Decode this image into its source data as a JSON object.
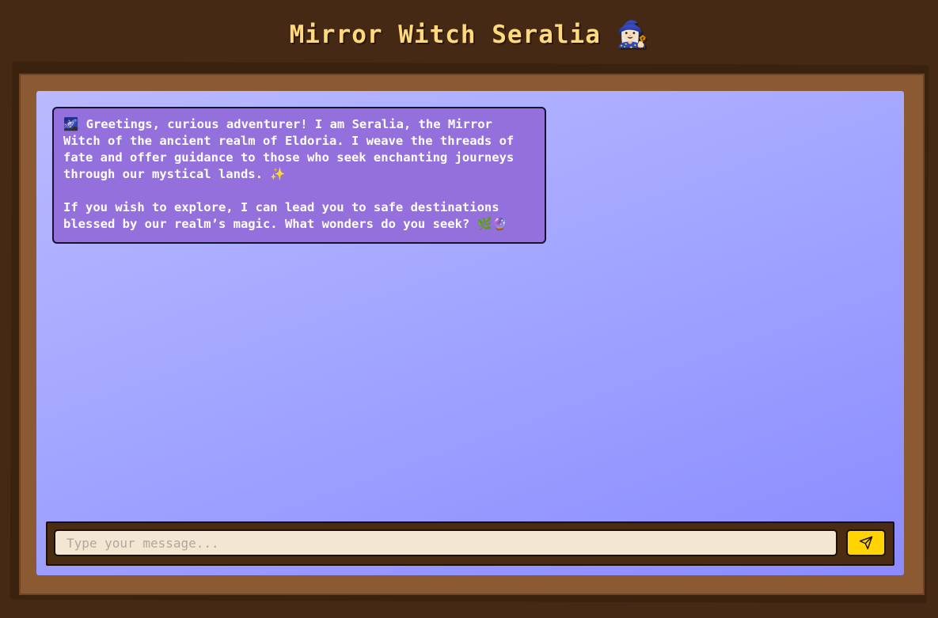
{
  "header": {
    "title": "Mirror Witch Seralia",
    "title_emoji": "🧙🏻‍♀️"
  },
  "chat": {
    "messages": [
      {
        "sender": "Seralia",
        "paragraphs": [
          "🌌 Greetings, curious adventurer! I am Seralia, the Mirror Witch of the ancient realm of Eldoria. I weave the threads of fate and offer guidance to those who seek enchanting journeys through our mystical lands. ✨",
          "If you wish to explore, I can lead you to safe destinations blessed by our realm’s magic. What wonders do you seek? 🌿🔮"
        ]
      }
    ]
  },
  "composer": {
    "placeholder": "Type your message...",
    "value": "",
    "send_icon": "send-icon"
  },
  "colors": {
    "background": "#452914",
    "frame": "#8b5a32",
    "chat_gradient_start": "#b9b9ff",
    "chat_gradient_end": "#8b8bff",
    "bubble": "#9370db",
    "title": "#ffd97a",
    "send_button": "#ffd400",
    "input_bg": "#f3e6d3"
  }
}
